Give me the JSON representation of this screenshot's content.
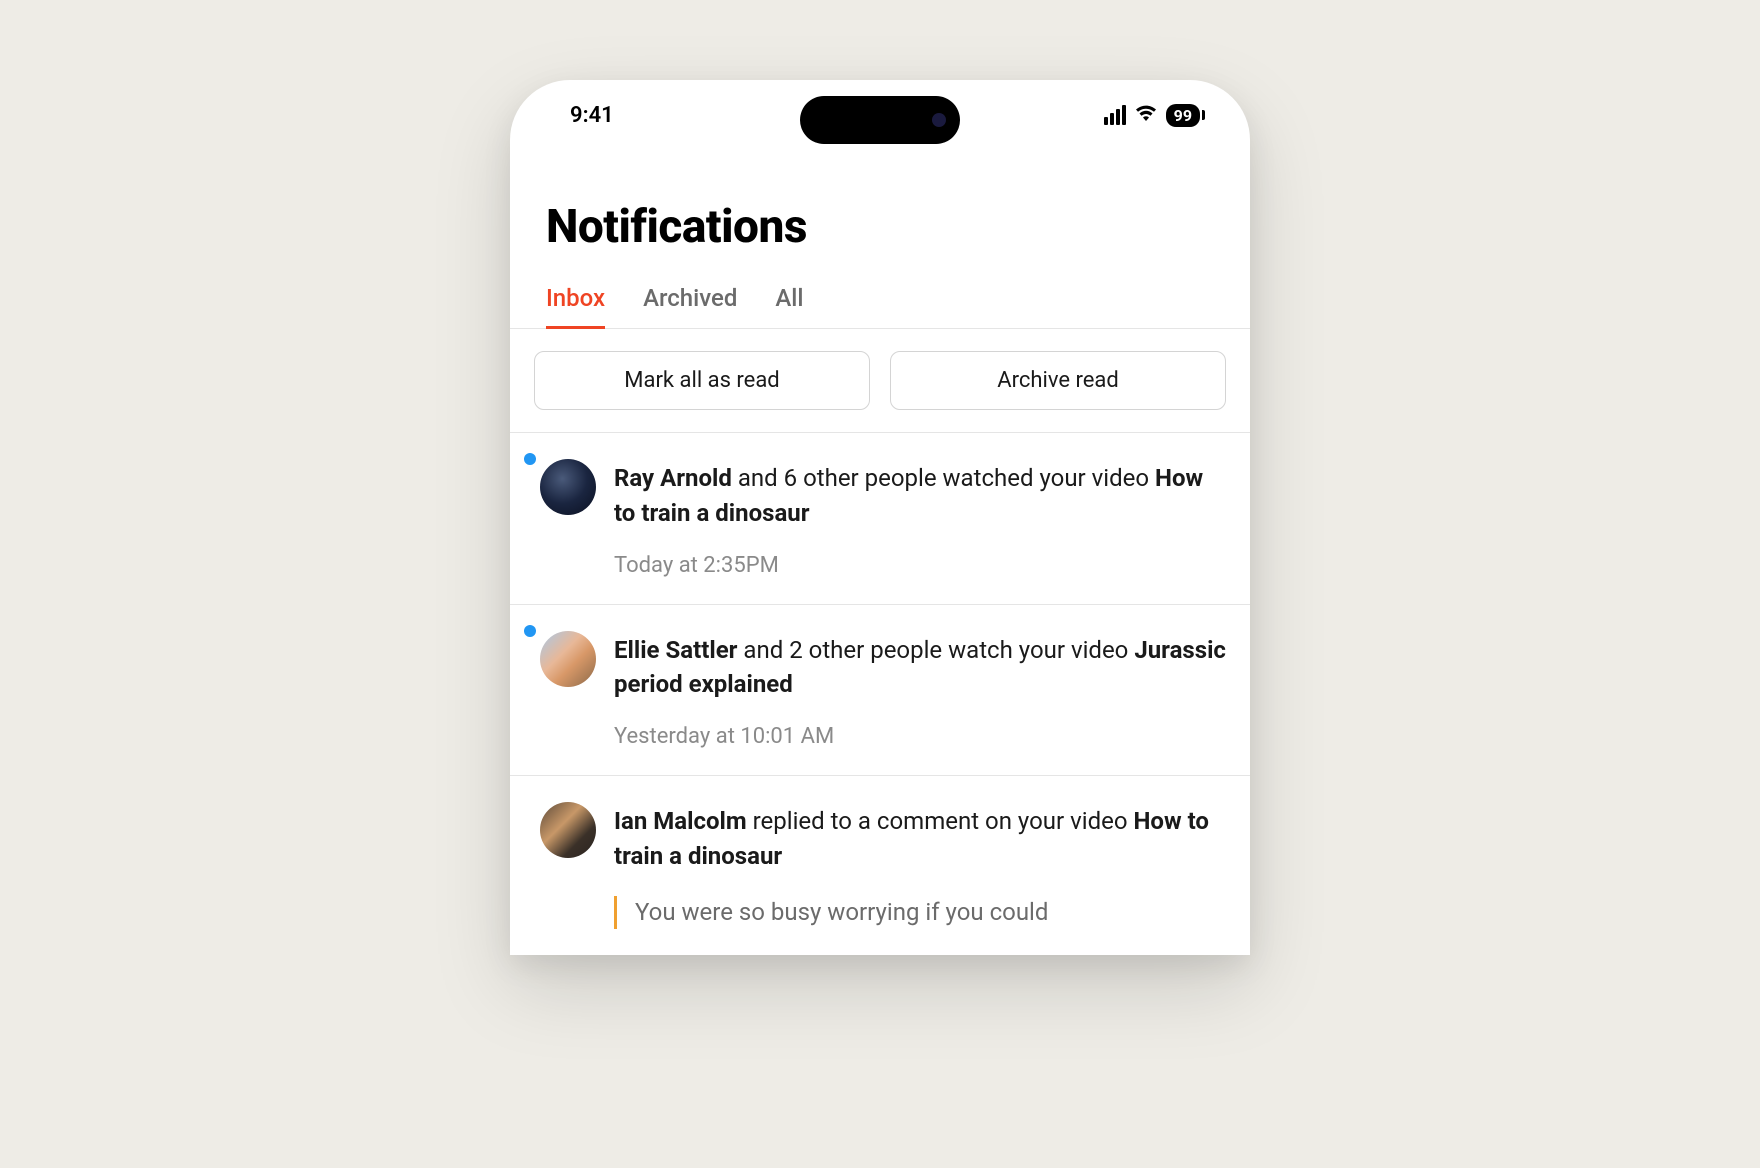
{
  "status_bar": {
    "time": "9:41",
    "battery": "99"
  },
  "header": {
    "title": "Notifications"
  },
  "tabs": [
    {
      "label": "Inbox",
      "active": true
    },
    {
      "label": "Archived",
      "active": false
    },
    {
      "label": "All",
      "active": false
    }
  ],
  "actions": {
    "mark_all_label": "Mark all as read",
    "archive_read_label": "Archive read"
  },
  "notifications": [
    {
      "unread": true,
      "actor": "Ray Arnold",
      "middle": " and 6 other people watched your video ",
      "subject": "How to train a dinosaur",
      "time": "Today at 2:35PM",
      "quote": ""
    },
    {
      "unread": true,
      "actor": "Ellie Sattler",
      "middle": " and 2 other people watch your video ",
      "subject": "Jurassic period explained",
      "time": "Yesterday at 10:01 AM",
      "quote": ""
    },
    {
      "unread": false,
      "actor": "Ian Malcolm",
      "middle": " replied to a comment on your video ",
      "subject": "How to train a dinosaur",
      "time": "",
      "quote": "You were so busy worrying if you could"
    }
  ]
}
